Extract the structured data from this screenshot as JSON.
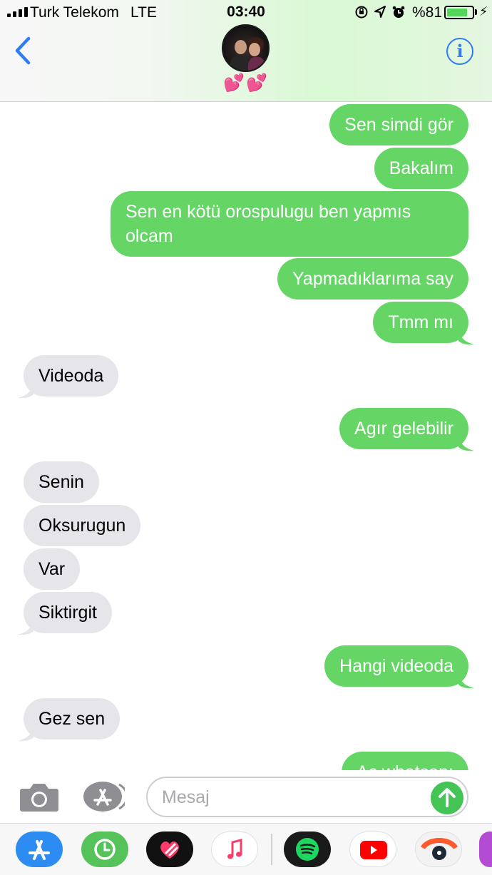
{
  "status_bar": {
    "carrier": "Turk Telekom",
    "network": "LTE",
    "time": "03:40",
    "battery_percent": "%81",
    "battery_level": 0.81
  },
  "header": {
    "contact_name": "💕💕",
    "back_icon": "chevron-left-icon",
    "info_icon": "info-icon"
  },
  "messages": [
    {
      "direction": "sent",
      "text": "Sen simdi gör"
    },
    {
      "direction": "sent",
      "text": "Bakalım"
    },
    {
      "direction": "sent",
      "text": "Sen en kötü orospulugu ben yapmıs olcam"
    },
    {
      "direction": "sent",
      "text": "Yapmadıklarıma say"
    },
    {
      "direction": "sent",
      "text": "Tmm mı"
    },
    {
      "direction": "received",
      "text": "Videoda"
    },
    {
      "direction": "sent",
      "text": "Agır gelebilir"
    },
    {
      "direction": "received",
      "text": "Senin"
    },
    {
      "direction": "received",
      "text": "Oksurugun"
    },
    {
      "direction": "received",
      "text": "Var"
    },
    {
      "direction": "received",
      "text": "Siktirgit"
    },
    {
      "direction": "sent",
      "text": "Hangi videoda"
    },
    {
      "direction": "received",
      "text": "Gez sen"
    },
    {
      "direction": "sent",
      "text": "Ac whatsapı"
    }
  ],
  "input": {
    "placeholder": "Mesaj"
  },
  "app_drawer": [
    "App Store",
    "Screen Time",
    "Digital Touch",
    "Music",
    "Spotify",
    "YouTube",
    "Camera app",
    "More"
  ],
  "colors": {
    "sent_bubble": "#65d666",
    "received_bubble": "#e6e5ea",
    "accent": "#2f7cf6",
    "send_button": "#44c454"
  }
}
